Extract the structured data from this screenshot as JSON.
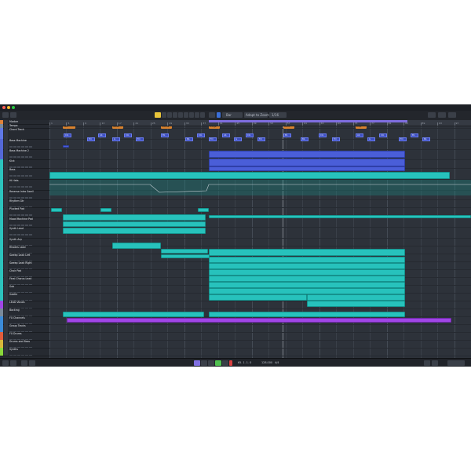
{
  "toolbar": {
    "grid_label": "Bar",
    "snap_label": "Adapt to Zoom",
    "quantize_label": "1/16"
  },
  "ruler": {
    "bars": [
      "1",
      "5",
      "9",
      "13",
      "17",
      "21",
      "25",
      "29",
      "33",
      "37",
      "41",
      "45",
      "49",
      "53",
      "57",
      "61",
      "65",
      "69",
      "73",
      "77",
      "81",
      "85",
      "89",
      "93",
      "97"
    ]
  },
  "markers": [
    "Intro",
    "Verse",
    "Chorus",
    "Bridge",
    "Outro",
    "Drop"
  ],
  "chords": [
    "Cm",
    "Fm",
    "Ab",
    "G",
    "Cm",
    "Fm",
    "Eb",
    "Bb",
    "Cm",
    "Fm",
    "Ab",
    "G",
    "Cm",
    "Fm",
    "Eb",
    "Bb",
    "Cm",
    "Fm",
    "Ab",
    "G",
    "Cm",
    "Fm",
    "Eb",
    "Bb"
  ],
  "tracks": [
    {
      "name": "Marker",
      "color": "#e0823a"
    },
    {
      "name": "Tempo",
      "color": "#7a8a9a"
    },
    {
      "name": "Chord Track",
      "color": "#5f78e8"
    },
    {
      "name": "Bass Machine",
      "color": "#5468d8"
    },
    {
      "name": "Bass Machine 2",
      "color": "#5468d8"
    },
    {
      "name": "Kick",
      "color": "#2cc3bd"
    },
    {
      "name": "Bass",
      "color": "#2cc3bd"
    },
    {
      "name": "Hi Hats",
      "color": "#2cc3bd"
    },
    {
      "name": "Reverse Intro Swell",
      "color": "#2cc3bd"
    },
    {
      "name": "Rhythm Gtr",
      "color": "#2cc3bd"
    },
    {
      "name": "Plucked Pad",
      "color": "#2cc3bd"
    },
    {
      "name": "Mood Machine Pad",
      "color": "#2cc3bd"
    },
    {
      "name": "Synth Lead",
      "color": "#2cc3bd"
    },
    {
      "name": "Synth Arp",
      "color": "#2cc3bd"
    },
    {
      "name": "Rhodes Lead",
      "color": "#2cc3bd"
    },
    {
      "name": "Sweep Lead Left",
      "color": "#2cc3bd"
    },
    {
      "name": "Sweep Lead Right",
      "color": "#2cc3bd"
    },
    {
      "name": "Choir Pad",
      "color": "#2cc3bd"
    },
    {
      "name": "Final Chorus Lead",
      "color": "#2cc3bd"
    },
    {
      "name": "Sub",
      "color": "#2cc3bd"
    },
    {
      "name": "Subtle",
      "color": "#2cc3bd"
    },
    {
      "name": "LEAD Vocals",
      "color": "#a046e6"
    },
    {
      "name": "Backing",
      "color": "#7a8a9a"
    },
    {
      "name": "FX Channels",
      "color": "#3b8bd8"
    },
    {
      "name": "Group Tracks",
      "color": "#3b8bd8"
    },
    {
      "name": "FX Drums",
      "color": "#e25c3b"
    },
    {
      "name": "Drums and Bass",
      "color": "#d8b83a"
    },
    {
      "name": "Synths",
      "color": "#8ad83a"
    }
  ],
  "transport": {
    "position": "65. 1. 1.  0",
    "tempo": "128.000",
    "signature": "4/4"
  },
  "colors": {
    "teal": "#27c2bc",
    "blue": "#4a5ed8",
    "purple": "#a046e6",
    "marker": "#d9832f",
    "cycle": "#7f6ee0"
  }
}
